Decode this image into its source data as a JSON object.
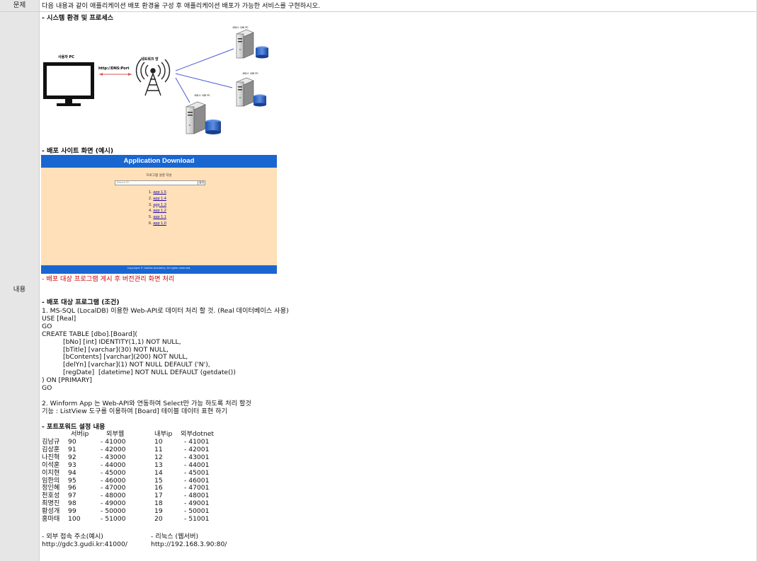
{
  "labels": {
    "problem": "문제",
    "content": "내용"
  },
  "problem_text": "다음 내용과 같이 애플리케이션 배포 환경을 구성 후 애플리케이션 배포가 가능한 서비스를 구현하시오.",
  "s1": {
    "heading": "- 시스템 환경 및 프로세스",
    "user_pc": "사용자 PC",
    "network": "네트워크 망",
    "http": "http://DNS:Port",
    "server1": "서비스 서버 PC",
    "server2": "서비스 서버 PC",
    "server3": "서비스 서버 PC"
  },
  "s2": {
    "heading": "- 배포 사이트 화면 (예시)",
    "app_title": "Application Download",
    "subtitle": "프로그램 설명 작성",
    "search_placeholder": "Search ID",
    "search_btn": "검색",
    "items": [
      {
        "num": "1.",
        "label": "app 1.5"
      },
      {
        "num": "2.",
        "label": "app 1.4"
      },
      {
        "num": "3.",
        "label": "app 1.3"
      },
      {
        "num": "4.",
        "label": "app 1.2"
      },
      {
        "num": "5.",
        "label": "app 1.1"
      },
      {
        "num": "6.",
        "label": "app 1.0"
      }
    ],
    "copyright": "Copyright © GoSlee Academy. All rights reserved.",
    "note": "- 배포 대상 프로그램 게시 후 버전관리 화면 처리"
  },
  "s3": {
    "heading": "- 배포 대상 프로그램 (조건)",
    "lines": [
      "1. MS-SQL (LocalDB) 이용한 Web-API로 데이터 처리 할 것. (Real 데이터베이스 사용)",
      "USE [Real]",
      "GO",
      "CREATE TABLE [dbo].[Board](",
      "\t[bNo] [int] IDENTITY(1,1) NOT NULL,",
      "\t[bTitle] [varchar](30) NOT NULL,",
      "\t[bContents] [varchar](200) NOT NULL,",
      "\t[delYn] [varchar](1) NOT NULL DEFAULT ('N'),",
      "\t[regDate]  [datetime] NOT NULL DEFAULT (getdate())",
      ") ON [PRIMARY]",
      "GO",
      "",
      "2. Winform App 는 Web-API와 연동하여 Select만 가능 하도록 처리 할것",
      "기능 : ListView 도구를 이용하여 [Board] 테이블 데이터 표현 하기"
    ]
  },
  "s4": {
    "heading": "- 포트포워드 설정 내용",
    "headers": [
      "서버ip",
      "외부웹",
      "내부ip",
      "외부dotnet"
    ],
    "rows": [
      [
        "김남규",
        "90",
        "- 41000",
        "10",
        "- 41001"
      ],
      [
        "김상훈",
        "91",
        "- 42000",
        "11",
        "- 42001"
      ],
      [
        "나진혁",
        "92",
        "- 43000",
        "12",
        "- 43001"
      ],
      [
        "이석훈",
        "93",
        "- 44000",
        "13",
        "- 44001"
      ],
      [
        "이지현",
        "94",
        "- 45000",
        "14",
        "- 45001"
      ],
      [
        "임한의",
        "95",
        "- 46000",
        "15",
        "- 46001"
      ],
      [
        "정인혜",
        "96",
        "- 47000",
        "16",
        "- 47001"
      ],
      [
        "천호성",
        "97",
        "- 48000",
        "17",
        "- 48001"
      ],
      [
        "최명진",
        "98",
        "- 49000",
        "18",
        "- 49001"
      ],
      [
        "황성개",
        "99",
        "- 50000",
        "19",
        "- 50001"
      ],
      [
        "홍마태",
        "100",
        "- 51000",
        "20",
        "- 51001"
      ]
    ],
    "ext_label": "- 외부 접속 주소(예시)",
    "ext_url": "http://gdc3.gudi.kr:41000/",
    "linux_label": "- 리눅스 (웹서버)",
    "linux_url": "http://192.168.3.90:80/"
  }
}
